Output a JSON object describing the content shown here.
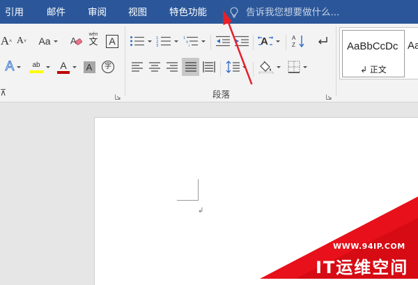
{
  "tabs": [
    {
      "label": "引用"
    },
    {
      "label": "邮件"
    },
    {
      "label": "审阅"
    },
    {
      "label": "视图"
    },
    {
      "label": "特色功能"
    }
  ],
  "tell_me": {
    "text": "告诉我您想要做什么..."
  },
  "ribbon": {
    "font_group": {
      "font_size_buttons": [
        "A",
        "A"
      ],
      "change_case_label": "Aa",
      "phonetic_label": "wén",
      "phonetic_char": "文",
      "char_border_label": "A",
      "highlight_label": "ab",
      "font_color_label": "A",
      "char_shading_label": "A",
      "enclose_char_label": "字",
      "group_label": "⊼"
    },
    "paragraph_group": {
      "group_label": "段落"
    },
    "styles": {
      "sample_text": "AaBbCcDc",
      "style_name": "↲ 正文",
      "next_sample": "Aa"
    }
  },
  "document": {
    "paragraph_mark": "↲"
  },
  "watermark": {
    "url": "WWW.94IP.COM",
    "title": "IT运维空间"
  },
  "colors": {
    "tab_bar": "#2b579a",
    "ribbon": "#f3f3f3",
    "highlight": "#ffff00",
    "font_color": "#c00000",
    "arrow": "#e8202a",
    "watermark": "#e8101a"
  }
}
